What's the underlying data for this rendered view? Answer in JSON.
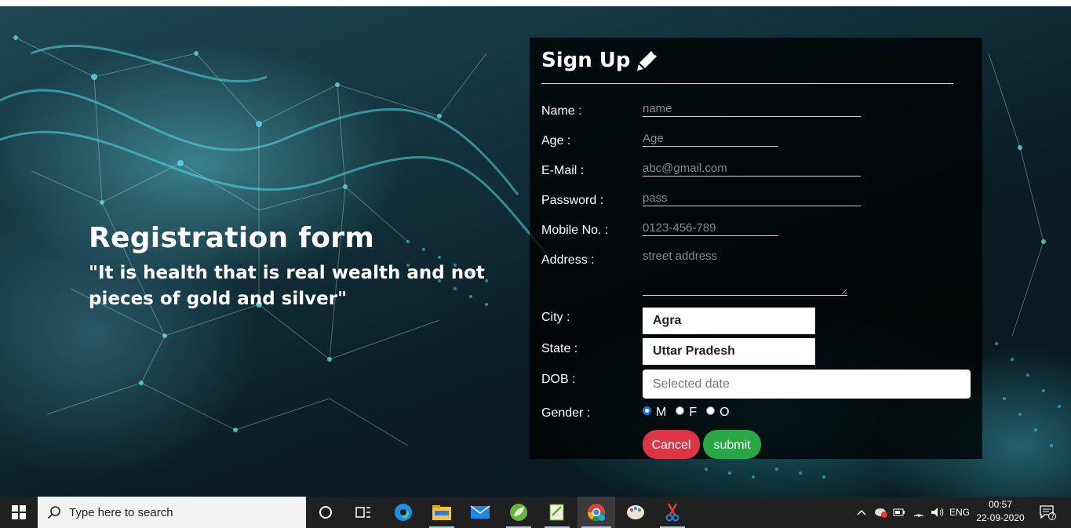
{
  "hero": {
    "title": "Registration form",
    "quote": "\"It is health that is real wealth and not pieces of gold and silver\""
  },
  "form": {
    "title": "Sign Up",
    "labels": {
      "name": "Name :",
      "age": "Age :",
      "email": "E-Mail :",
      "password": "Password :",
      "mobile": "Mobile No. :",
      "address": "Address :",
      "city": "City :",
      "state": "State :",
      "dob": "DOB :",
      "gender": "Gender :"
    },
    "placeholders": {
      "name": "name",
      "age": "Age",
      "email": "abc@gmail.com",
      "password": "pass",
      "mobile": "0123-456-789",
      "address": "street address"
    },
    "city_value": "Agra",
    "state_value": "Uttar Pradesh",
    "dob_placeholder": "Selected date",
    "gender_options": [
      "M",
      "F",
      "O"
    ],
    "gender_selected": "M",
    "cancel_label": "Cancel",
    "submit_label": "submit",
    "colors": {
      "cancel": "#dc3545",
      "submit": "#28a745"
    }
  },
  "taskbar": {
    "search_placeholder": "Type here to search",
    "language": "ENG",
    "time": "00:57",
    "date": "22-09-2020",
    "notification_count": "7"
  }
}
